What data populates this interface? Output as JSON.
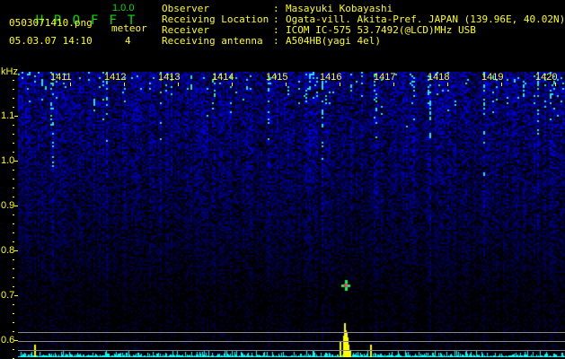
{
  "app": {
    "title_letters": [
      "H",
      "R",
      "O",
      "F",
      "F",
      "T"
    ],
    "version": "1.0.0",
    "filename": "0503071410.png",
    "datetime": "05.03.07 14:10",
    "meteor_label": "meteor",
    "meteor_count": "4"
  },
  "info": [
    {
      "label": "Observer",
      "value": "Masayuki Kobayashi"
    },
    {
      "label": "Receiving Location",
      "value": "Ogata-vill. Akita-Pref. JAPAN (139.96E, 40.02N)"
    },
    {
      "label": "Receiver",
      "value": "ICOM IC-575 53.7492(@LCD)MHz USB"
    },
    {
      "label": "Receiving antenna",
      "value": "A504HB(yagi 4el)"
    }
  ],
  "chart_data": {
    "type": "heatmap",
    "ylabel": "kHz",
    "y_ticks": [
      "1.1",
      "1.0",
      "0.9",
      "0.8",
      "0.7",
      "0.6"
    ],
    "x_ticks": [
      "1411",
      "1412",
      "1413",
      "1414",
      "1415",
      "1416",
      "1417",
      "1418",
      "1419",
      "1420"
    ],
    "ylim": [
      0.56,
      1.19
    ],
    "meteor_echo": {
      "time": "1416.5",
      "freq_khz": 0.72
    },
    "colors": {
      "axis": "#ffff00",
      "title": "#00e000",
      "histogram": "#00ffff",
      "detection": "#ffff00",
      "threshold_lines": "#888888"
    }
  }
}
